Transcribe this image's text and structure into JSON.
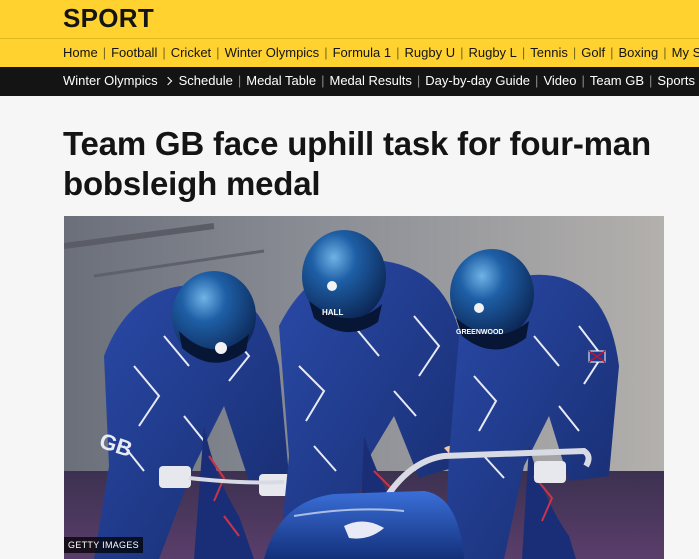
{
  "header": {
    "brand": "SPORT"
  },
  "nav_primary": {
    "items": [
      {
        "label": "Home"
      },
      {
        "label": "Football"
      },
      {
        "label": "Cricket"
      },
      {
        "label": "Winter Olympics"
      },
      {
        "label": "Formula 1"
      },
      {
        "label": "Rugby U"
      },
      {
        "label": "Rugby L"
      },
      {
        "label": "Tennis"
      },
      {
        "label": "Golf"
      },
      {
        "label": "Boxing"
      },
      {
        "label": "My Sport"
      }
    ]
  },
  "nav_secondary": {
    "section": "Winter Olympics",
    "items": [
      {
        "label": "Schedule"
      },
      {
        "label": "Medal Table"
      },
      {
        "label": "Medal Results"
      },
      {
        "label": "Day-by-day Guide"
      },
      {
        "label": "Video"
      },
      {
        "label": "Team GB"
      },
      {
        "label": "Sports"
      }
    ]
  },
  "article": {
    "headline": "Team GB face uphill task for four-man bobsleigh medal",
    "image": {
      "credit": "GETTY IMAGES",
      "helmet_names": [
        "HALL",
        "GREENWOOD"
      ],
      "suit_letters": "GB"
    }
  },
  "colors": {
    "brand_yellow": "#ffd230",
    "nav_dark": "#141414",
    "page_bg": "#f6f6f6",
    "suit_blue": "#1f3a8a"
  }
}
